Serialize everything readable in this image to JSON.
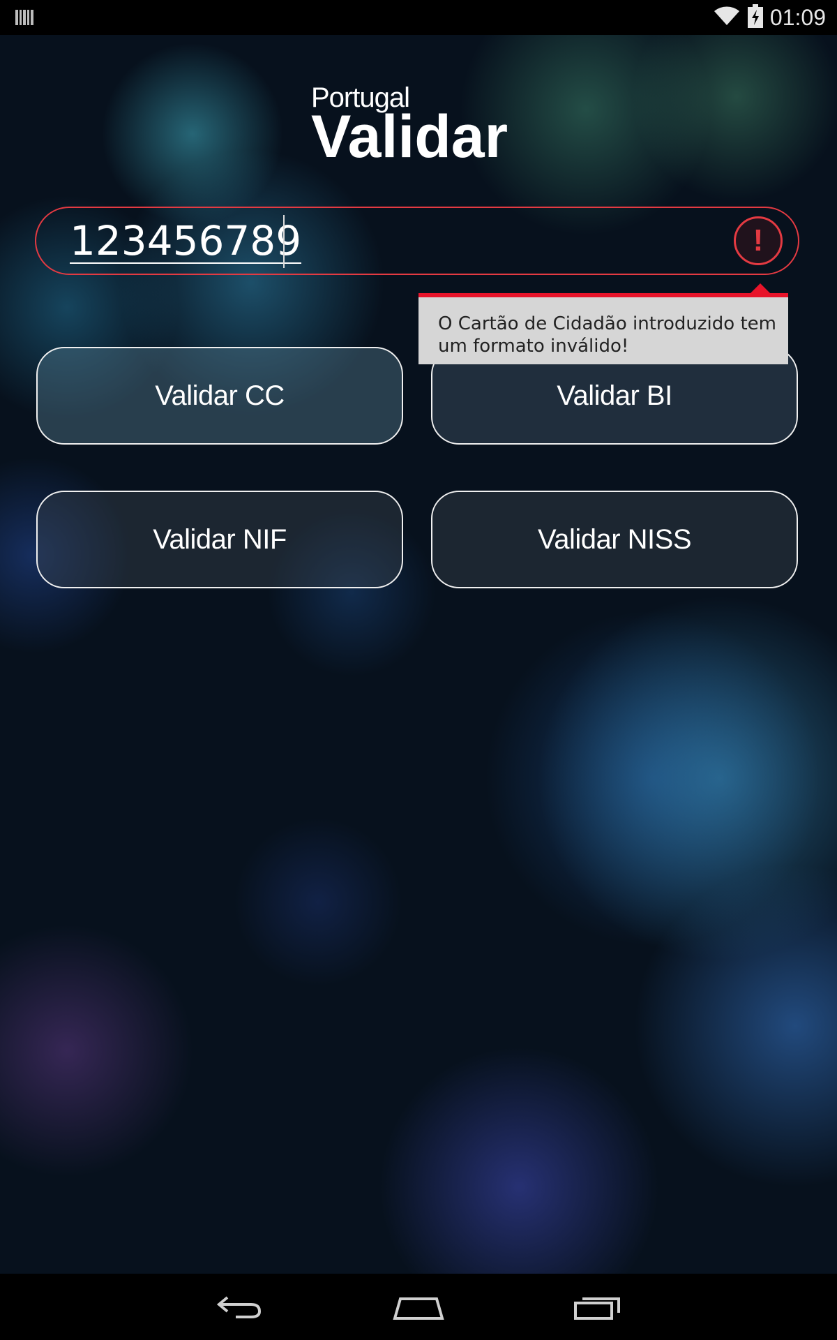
{
  "status_bar": {
    "time": "01:09",
    "icons": [
      "barcode-icon",
      "wifi-icon",
      "battery-charging-icon"
    ]
  },
  "logo": {
    "small_text": "Portugal",
    "big_text": "Validar"
  },
  "input": {
    "value": "123456789",
    "error_icon_symbol": "!"
  },
  "error_tooltip": {
    "message": "O Cartão de Cidadão introduzido tem um formato inválido!"
  },
  "buttons": {
    "validar_cc": "Validar CC",
    "validar_bi": "Validar BI",
    "validar_nif": "Validar NIF",
    "validar_niss": "Validar NISS"
  },
  "nav_bar": {
    "icons": [
      "back-icon",
      "home-icon",
      "recent-apps-icon"
    ]
  },
  "colors": {
    "error": "#e33a42",
    "tooltip_bg": "#d6d6d6",
    "button_border": "#f0f0f0"
  }
}
